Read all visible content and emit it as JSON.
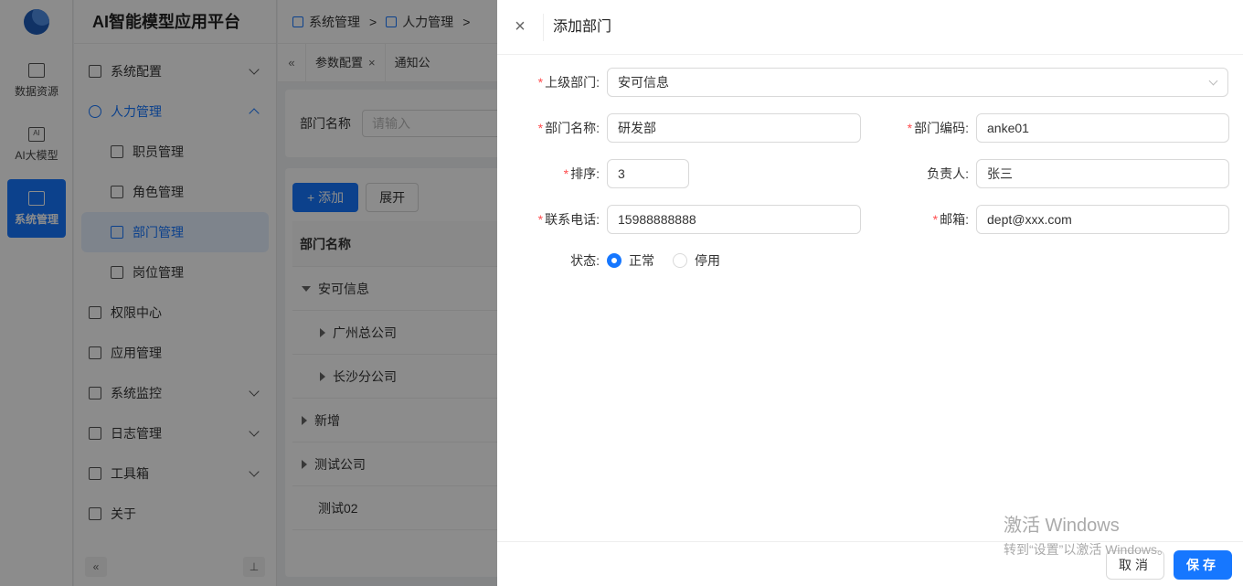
{
  "rail": {
    "items": [
      {
        "label": "数据资源",
        "icon": "grid-chart-icon"
      },
      {
        "label": "AI大模型",
        "icon": "ai-icon",
        "glyph": "AI"
      },
      {
        "label": "系统管理",
        "icon": "system-icon",
        "active": true
      }
    ]
  },
  "sidebar": {
    "brand": "AI智能模型应用平台",
    "items": [
      {
        "label": "系统配置"
      },
      {
        "label": "人力管理"
      },
      {
        "label": "职员管理"
      },
      {
        "label": "角色管理"
      },
      {
        "label": "部门管理"
      },
      {
        "label": "岗位管理"
      },
      {
        "label": "权限中心"
      },
      {
        "label": "应用管理"
      },
      {
        "label": "系统监控"
      },
      {
        "label": "日志管理"
      },
      {
        "label": "工具箱"
      },
      {
        "label": "关于"
      }
    ],
    "footer": {
      "collapse": "«",
      "pin": "⊥"
    }
  },
  "topbar": {
    "breadcrumb": [
      "系统管理",
      "人力管理"
    ],
    "separator": ">"
  },
  "tabs": {
    "collapse": "«",
    "items": [
      {
        "label": "参数配置",
        "close": "×"
      },
      {
        "label": "通知公"
      }
    ]
  },
  "search": {
    "label": "部门名称",
    "placeholder": "请输入"
  },
  "table": {
    "add_button": "+ 添加",
    "expand_button": "展开",
    "header": "部门名称",
    "rows": [
      "安可信息",
      "广州总公司",
      "长沙分公司",
      "新增",
      "测试公司",
      "测试02"
    ]
  },
  "drawer": {
    "close": "×",
    "title": "添加部门",
    "form": {
      "parent_label": "上级部门",
      "parent_value": "安可信息",
      "name_label": "部门名称",
      "name_value": "研发部",
      "code_label": "部门编码",
      "code_value": "anke01",
      "sort_label": "排序",
      "sort_value": "3",
      "leader_label": "负责人",
      "leader_value": "张三",
      "phone_label": "联系电话",
      "phone_value": "15988888888",
      "email_label": "邮箱",
      "email_value": "dept@xxx.com",
      "status_label": "状态",
      "status_options": [
        "正常",
        "停用"
      ],
      "status_selected": "正常",
      "colon": ":",
      "required_mark": "*"
    },
    "footer": {
      "cancel": "取消",
      "save": "保存"
    }
  },
  "watermark": {
    "line1": "激活 Windows",
    "line2": "转到“设置”以激活 Windows。"
  },
  "colors": {
    "primary": "#1677ff",
    "required": "#ff4d4f"
  }
}
